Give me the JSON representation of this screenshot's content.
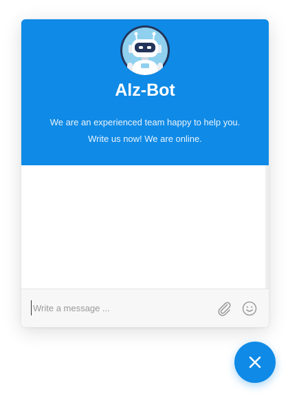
{
  "widget": {
    "bot_name": "Alz-Bot",
    "tagline_line1": "We are an experienced team happy to help you.",
    "tagline_line2": "Write us now! We are online.",
    "avatar_icon": "robot-icon"
  },
  "composer": {
    "placeholder": "Write a message ...",
    "value": "",
    "attach_icon": "paperclip-icon",
    "emoji_icon": "smiley-icon"
  },
  "launcher": {
    "close_icon": "close-icon"
  },
  "colors": {
    "accent": "#0f8ae6",
    "header_text": "#ffffff",
    "composer_bg": "#f7f7f7"
  }
}
